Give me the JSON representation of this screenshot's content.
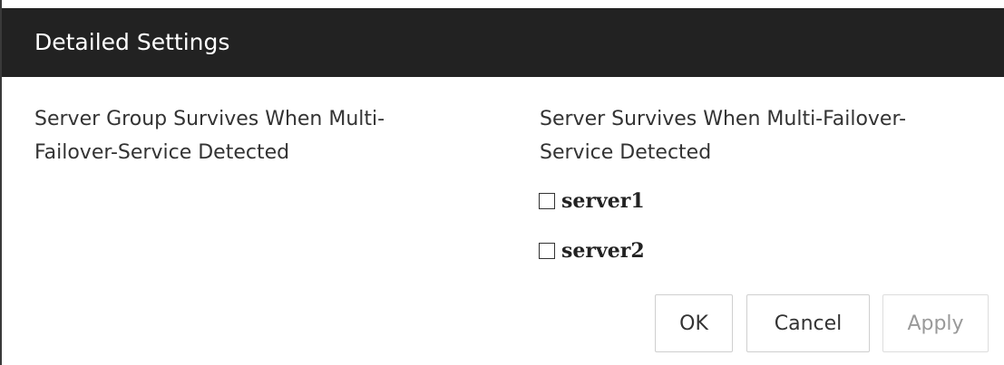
{
  "dialog": {
    "title": "Detailed Settings",
    "left_label": "Server Group Survives When Multi-\nFailover-Service Detected",
    "right_label": "Server Survives When Multi-Failover-\nService Detected",
    "servers": [
      {
        "label": "server1",
        "checked": false
      },
      {
        "label": "server2",
        "checked": false
      }
    ],
    "buttons": {
      "ok": "OK",
      "cancel": "Cancel",
      "apply": "Apply"
    }
  }
}
